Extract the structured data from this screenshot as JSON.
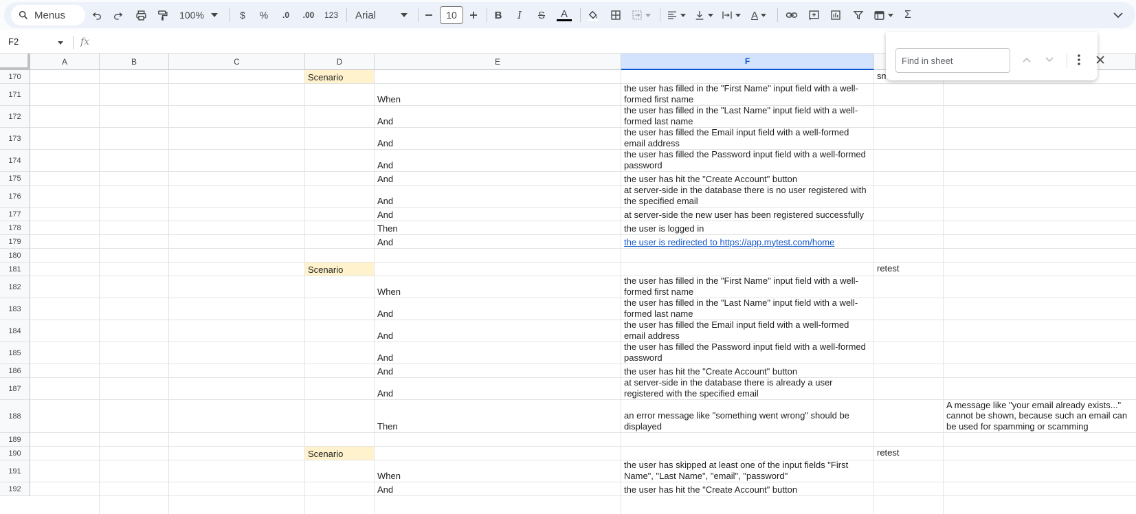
{
  "toolbar": {
    "menus_label": "Menus",
    "zoom": "100%",
    "currency": "$",
    "percent": "%",
    "dec_decrease": ".0",
    "dec_increase": ".00",
    "number_format": "123",
    "font": "Arial",
    "font_size": "10",
    "icons": [
      "search-icon",
      "undo-icon",
      "redo-icon",
      "print-icon",
      "paint-format-icon",
      "minus-icon",
      "plus-icon",
      "bold-icon",
      "italic-icon",
      "strikethrough-icon",
      "text-color-icon",
      "fill-color-icon",
      "borders-icon",
      "merge-icon",
      "align-icon",
      "valign-icon",
      "wrap-icon",
      "rotate-icon",
      "link-icon",
      "comment-icon",
      "chart-icon",
      "filter-icon",
      "table-icon",
      "functions-icon",
      "collapse-icon"
    ]
  },
  "formula_bar": {
    "cell_ref": "F2",
    "fx": "fx"
  },
  "find": {
    "placeholder": "Find in sheet"
  },
  "columns": [
    "A",
    "B",
    "C",
    "D",
    "E",
    "F",
    "",
    ""
  ],
  "selected_column": "F",
  "rows": [
    {
      "num": "170",
      "D": "Scenario",
      "E": "",
      "F": "",
      "G": "smoke",
      "H": ""
    },
    {
      "num": "171",
      "D": "",
      "E": "When",
      "F": "the user has filled in the \"First Name\" input field with a well-formed first name",
      "G": "",
      "H": ""
    },
    {
      "num": "172",
      "D": "",
      "E": "And",
      "F": "the user has filled in the \"Last Name\" input field with a well-formed last name",
      "G": "",
      "H": ""
    },
    {
      "num": "173",
      "D": "",
      "E": "And",
      "F": "the user has filled the Email input field with a well-formed email address",
      "G": "",
      "H": ""
    },
    {
      "num": "174",
      "D": "",
      "E": "And",
      "F": "the user has filled the Password input field with a well-formed password",
      "G": "",
      "H": ""
    },
    {
      "num": "175",
      "D": "",
      "E": "And",
      "F": "the user has hit the \"Create Account\" button",
      "G": "",
      "H": ""
    },
    {
      "num": "176",
      "D": "",
      "E": "And",
      "F": "at server-side in the database there is no user registered with the specified email",
      "G": "",
      "H": ""
    },
    {
      "num": "177",
      "D": "",
      "E": "And",
      "F": "at server-side the new user has been registered successfully",
      "G": "",
      "H": ""
    },
    {
      "num": "178",
      "D": "",
      "E": "Then",
      "F": "the user is logged in",
      "G": "",
      "H": ""
    },
    {
      "num": "179",
      "D": "",
      "E": "And",
      "F": "the user is redirected to https://app.mytest.com/home",
      "G": "",
      "H": ""
    },
    {
      "num": "180",
      "D": "",
      "E": "",
      "F": "",
      "G": "",
      "H": ""
    },
    {
      "num": "181",
      "D": "Scenario",
      "E": "",
      "F": "",
      "G": "retest",
      "H": ""
    },
    {
      "num": "182",
      "D": "",
      "E": "When",
      "F": "the user has filled in the \"First Name\" input field with a well-formed first name",
      "G": "",
      "H": ""
    },
    {
      "num": "183",
      "D": "",
      "E": "And",
      "F": "the user has filled in the \"Last Name\" input field with a well-formed last name",
      "G": "",
      "H": ""
    },
    {
      "num": "184",
      "D": "",
      "E": "And",
      "F": "the user has filled the Email input field with a well-formed email address",
      "G": "",
      "H": ""
    },
    {
      "num": "185",
      "D": "",
      "E": "And",
      "F": "the user has filled the Password input field with a well-formed password",
      "G": "",
      "H": ""
    },
    {
      "num": "186",
      "D": "",
      "E": "And",
      "F": "the user has hit the \"Create Account\" button",
      "G": "",
      "H": ""
    },
    {
      "num": "187",
      "D": "",
      "E": "And",
      "F": "at server-side in the database there is already a user registered with the specified email",
      "G": "",
      "H": ""
    },
    {
      "num": "188",
      "D": "",
      "E": "Then",
      "F": "an error message like \"something went wrong\" should be displayed",
      "G": "",
      "H": "A message like \"your email already exists...\" cannot be shown, because such an email can be used for spamming or scamming"
    },
    {
      "num": "189",
      "D": "",
      "E": "",
      "F": "",
      "G": "",
      "H": ""
    },
    {
      "num": "190",
      "D": "Scenario",
      "E": "",
      "F": "",
      "G": "retest",
      "H": ""
    },
    {
      "num": "191",
      "D": "",
      "E": "When",
      "F": "the user has skipped at least one of the input fields \"First Name\", \"Last Name\", \"email\", \"password\"",
      "G": "",
      "H": ""
    },
    {
      "num": "192",
      "D": "",
      "E": "And",
      "F": "the user has hit the \"Create Account\" button",
      "G": "",
      "H": ""
    }
  ]
}
